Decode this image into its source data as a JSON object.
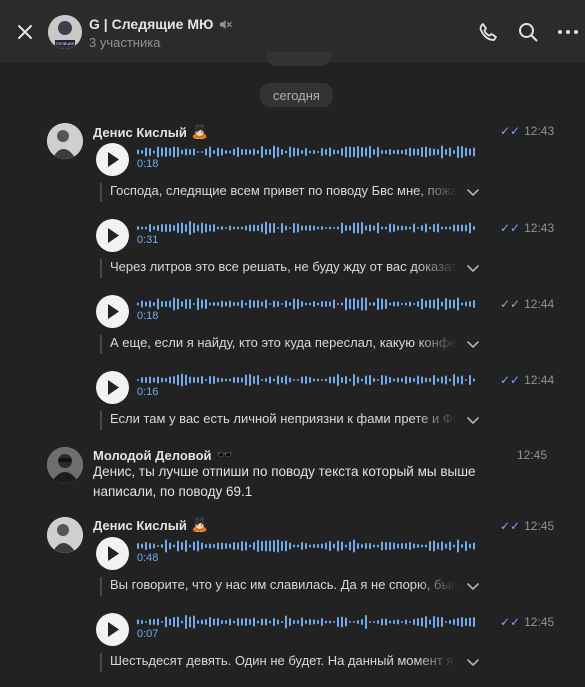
{
  "header": {
    "title": "G | Следящие МЮ",
    "subtitle": "3 участника",
    "avatar_label": "полиция"
  },
  "date_separator": "сегодня",
  "messages": [
    {
      "type": "voice",
      "sender": "Денис Кислый",
      "time": "12:43",
      "duration": "0:18",
      "transcript": "Господа, следящие всем привет по поводу Бвс мне, пожалуйста"
    },
    {
      "type": "voice",
      "time": "12:43",
      "duration": "0:31",
      "transcript": "Через литров это все решать, не буду жду от вас доказательств"
    },
    {
      "type": "voice",
      "time": "12:44",
      "duration": "0:18",
      "transcript": "А еще, если я найду, кто это куда переслал, какую конференцию"
    },
    {
      "type": "voice",
      "time": "12:44",
      "duration": "0:16",
      "transcript": "Если там у вас есть личной неприязни к фами прете и Фбр"
    },
    {
      "type": "text",
      "sender": "Молодой Деловой",
      "time": "12:45",
      "text": "Денис, ты лучше отпиши по поводу текста который мы выше написали, по поводу 69.1"
    },
    {
      "type": "voice",
      "sender": "Денис Кислый",
      "time": "12:45",
      "duration": "0:48",
      "transcript": "Вы говорите, что у нас им славилась. Да я не спорю, было"
    },
    {
      "type": "voice",
      "time": "12:45",
      "duration": "0:07",
      "transcript": "Шестьдесят девять. Один не будет. На данный момент я"
    }
  ],
  "icons": {
    "close": "close-icon",
    "call": "phone-icon",
    "search": "search-icon",
    "more": "more-horizontal-icon",
    "mute": "muted-speaker-icon",
    "play": "play-icon",
    "expand": "chevron-down-icon",
    "read": "double-check-icon"
  },
  "colors": {
    "accent": "#71aaeb",
    "background": "#222222",
    "header": "#2b2b2b"
  }
}
